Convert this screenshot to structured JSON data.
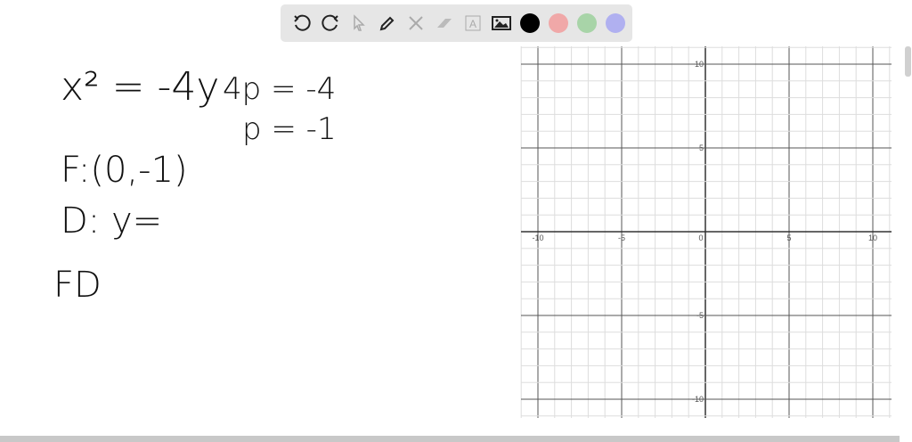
{
  "toolbar": {
    "tools": [
      "undo-icon",
      "redo-icon",
      "select-icon",
      "pen-icon",
      "tools-icon",
      "eraser-icon",
      "text-icon",
      "image-icon"
    ],
    "colors": [
      "#000000",
      "#f0a8a8",
      "#a8d4a8",
      "#b0b0f0"
    ]
  },
  "notes": {
    "line1_eq": "x² = -4y",
    "line1_side": "4p = -4",
    "line2": "p = -1",
    "focus": "F:(0,-1)",
    "directrix": "D: y=",
    "fd": "FD"
  },
  "chart_data": {
    "type": "line",
    "title": "",
    "xlabel": "",
    "ylabel": "",
    "xlim": [
      -11,
      11
    ],
    "ylim": [
      -11,
      11
    ],
    "grid": true,
    "series": [],
    "x_ticks": [
      "-10",
      "-5",
      "0",
      "5",
      "10"
    ],
    "y_ticks": [
      "10",
      "5",
      "-5",
      "-10"
    ]
  }
}
